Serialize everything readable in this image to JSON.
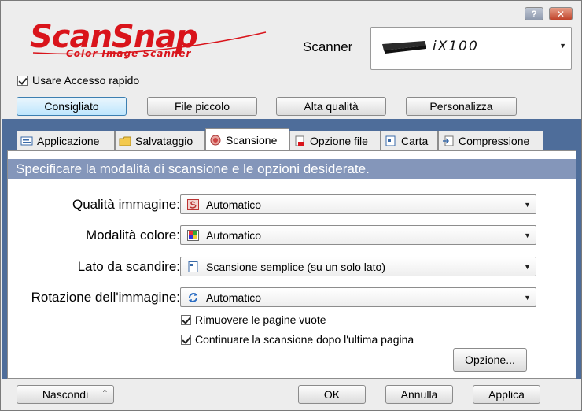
{
  "title_buttons": {
    "help": "?",
    "close": "✕"
  },
  "logo": {
    "main": "ScanSnap",
    "sub": "Color Image Scanner"
  },
  "scanner": {
    "label": "Scanner",
    "model": "iX100"
  },
  "quick_access": {
    "label": "Usare Accesso rapido",
    "checked": true
  },
  "presets": [
    "Consigliato",
    "File piccolo",
    "Alta qualità",
    "Personalizza"
  ],
  "tabs": [
    {
      "label": "Applicazione",
      "icon": "application-icon"
    },
    {
      "label": "Salvataggio",
      "icon": "save-folder-icon"
    },
    {
      "label": "Scansione",
      "icon": "scan-icon"
    },
    {
      "label": "Opzione file",
      "icon": "file-option-icon"
    },
    {
      "label": "Carta",
      "icon": "paper-icon"
    },
    {
      "label": "Compressione",
      "icon": "compression-icon"
    }
  ],
  "panel": {
    "header": "Specificare la modalità di scansione e le opzioni desiderate.",
    "fields": [
      {
        "label": "Qualità immagine:",
        "value": "Automatico",
        "icon": "quality-icon"
      },
      {
        "label": "Modalità colore:",
        "value": "Automatico",
        "icon": "color-mode-icon"
      },
      {
        "label": "Lato da scandire:",
        "value": "Scansione semplice (su un solo lato)",
        "icon": "scan-side-icon"
      },
      {
        "label": "Rotazione dell'immagine:",
        "value": "Automatico",
        "icon": "rotation-icon"
      }
    ],
    "checkboxes": [
      {
        "label": "Rimuovere le pagine vuote",
        "checked": true
      },
      {
        "label": "Continuare la scansione dopo l'ultima pagina",
        "checked": true
      }
    ],
    "option_button": "Opzione..."
  },
  "bottom": {
    "hide": "Nascondi",
    "ok": "OK",
    "cancel": "Annulla",
    "apply": "Applica"
  },
  "colors": {
    "brand_red": "#d9141b",
    "band_blue": "#4e6d9a",
    "header_blue": "#8496ba"
  }
}
